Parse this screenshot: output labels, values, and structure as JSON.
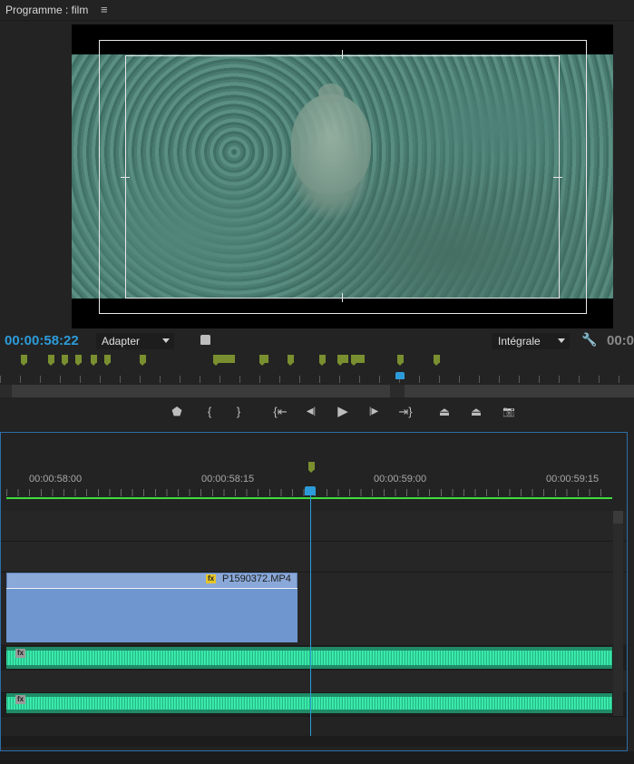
{
  "panel": {
    "title": "Programme : film",
    "menu_icon": "hamburger-menu-icon"
  },
  "monitor": {
    "timecode": "00:00:58:22",
    "fit": "Adapter",
    "quality": "Intégrale",
    "duration_timecode": "00:0",
    "settings_icon": "wrench-icon"
  },
  "transport": [
    {
      "name": "add-marker-button",
      "icon": "marker-icon",
      "glyph": "⬟"
    },
    {
      "name": "mark-in-button",
      "icon": "mark-in-icon",
      "glyph": "{"
    },
    {
      "name": "mark-out-button",
      "icon": "mark-out-icon",
      "glyph": "}"
    },
    {
      "name": "go-to-in-button",
      "icon": "go-to-in-icon",
      "glyph": "{⇤"
    },
    {
      "name": "step-back-button",
      "icon": "step-back-icon",
      "glyph": "◀|"
    },
    {
      "name": "play-button",
      "icon": "play-icon",
      "glyph": "▶"
    },
    {
      "name": "step-forward-button",
      "icon": "step-forward-icon",
      "glyph": "|▶"
    },
    {
      "name": "go-to-out-button",
      "icon": "go-to-out-icon",
      "glyph": "⇥}"
    },
    {
      "name": "lift-button",
      "icon": "lift-icon",
      "glyph": "⏏"
    },
    {
      "name": "extract-button",
      "icon": "extract-icon",
      "glyph": "⏏"
    },
    {
      "name": "export-frame-button",
      "icon": "camera-icon",
      "glyph": "📷"
    }
  ],
  "timeline": {
    "ruler_labels": [
      "00:00:58:00",
      "00:00:58:15",
      "00:00:59:00",
      "00:00:59:15"
    ],
    "video_clip": {
      "name": "P1590372.MP4",
      "fx": "fx"
    },
    "audio_clips": [
      {
        "fx": "fx"
      },
      {
        "fx": "fx"
      }
    ]
  }
}
